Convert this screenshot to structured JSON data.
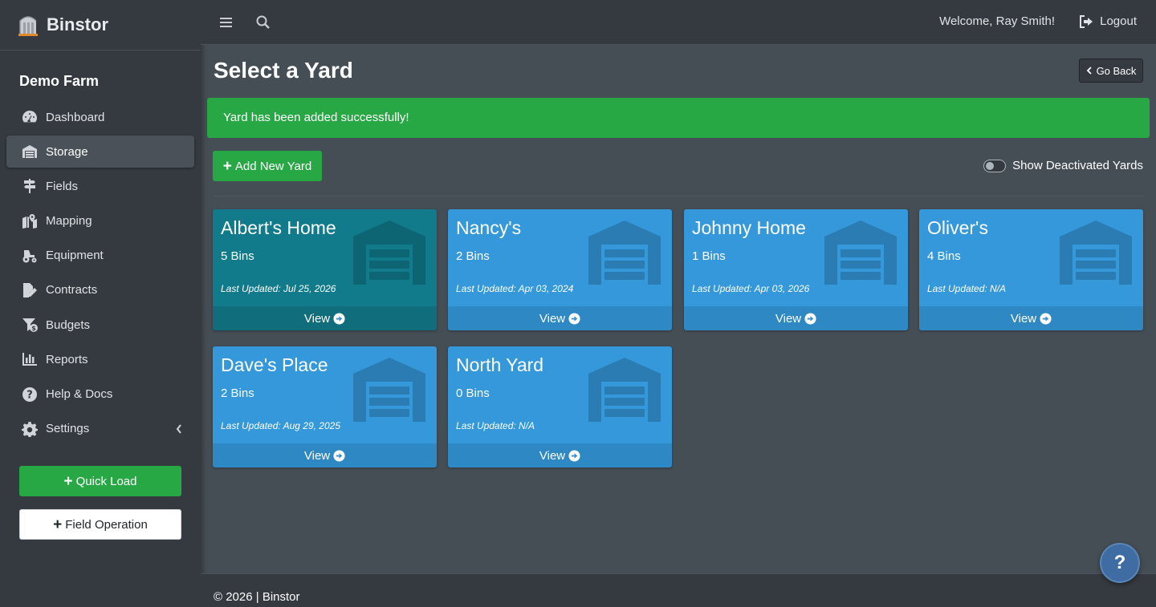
{
  "brand": {
    "name": "Binstor",
    "icon": "silo-logo-icon"
  },
  "sidebar": {
    "farm_name": "Demo Farm",
    "items": [
      {
        "label": "Dashboard",
        "icon": "gauge-icon",
        "active": false
      },
      {
        "label": "Storage",
        "icon": "warehouse-icon",
        "active": true
      },
      {
        "label": "Fields",
        "icon": "signpost-icon",
        "active": false
      },
      {
        "label": "Mapping",
        "icon": "map-marker-icon",
        "active": false
      },
      {
        "label": "Equipment",
        "icon": "tractor-icon",
        "active": false
      },
      {
        "label": "Contracts",
        "icon": "file-signature-icon",
        "active": false
      },
      {
        "label": "Budgets",
        "icon": "funnel-dollar-icon",
        "active": false
      },
      {
        "label": "Reports",
        "icon": "chart-bar-icon",
        "active": false
      },
      {
        "label": "Help & Docs",
        "icon": "question-circle-icon",
        "active": false
      },
      {
        "label": "Settings",
        "icon": "gear-icon",
        "active": false
      }
    ],
    "quick_load_label": "Quick Load",
    "field_operation_label": "Field Operation"
  },
  "topbar": {
    "welcome_text": "Welcome, Ray Smith!",
    "logout_label": "Logout"
  },
  "page": {
    "title": "Select a Yard",
    "go_back_label": "Go Back",
    "alert_text": "Yard has been added successfully!",
    "add_yard_label": "Add New Yard",
    "toggle_label": "Show Deactivated Yards"
  },
  "yards": [
    {
      "name": "Albert's Home",
      "bins": "5 Bins",
      "updated": "Last Updated: Jul 25, 2026",
      "view": "View",
      "color": "#117a8b"
    },
    {
      "name": "Nancy's",
      "bins": "2 Bins",
      "updated": "Last Updated: Apr 03, 2024",
      "view": "View",
      "color": "#3498db"
    },
    {
      "name": "Johnny Home",
      "bins": "1 Bins",
      "updated": "Last Updated: Apr 03, 2026",
      "view": "View",
      "color": "#3498db"
    },
    {
      "name": "Oliver's",
      "bins": "4 Bins",
      "updated": "Last Updated: N/A",
      "view": "View",
      "color": "#3498db"
    },
    {
      "name": "Dave's Place",
      "bins": "2 Bins",
      "updated": "Last Updated: Aug 29, 2025",
      "view": "View",
      "color": "#3498db"
    },
    {
      "name": "North Yard",
      "bins": "0 Bins",
      "updated": "Last Updated: N/A",
      "view": "View",
      "color": "#3498db"
    }
  ],
  "footer": {
    "text": "© 2026 | Binstor"
  },
  "help_button": {
    "label": "?"
  },
  "colors": {
    "success": "#28a745",
    "card_blue": "#3498db",
    "card_teal": "#117a8b",
    "sidebar": "#343a40",
    "content": "#454d55"
  }
}
